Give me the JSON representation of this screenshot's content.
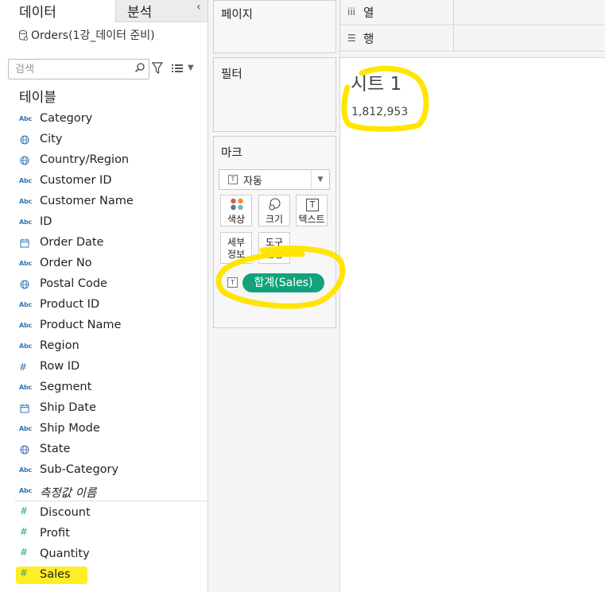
{
  "sidebar": {
    "tab_data": "데이터",
    "tab_analysis": "분석",
    "collapse_glyph": "‹",
    "datasource": "Orders(1강_데이터 준비)",
    "search_placeholder": "검색",
    "tables_heading": "테이블",
    "dimensions": [
      {
        "type": "Abc",
        "name": "Category"
      },
      {
        "type": "globe",
        "name": "City"
      },
      {
        "type": "globe",
        "name": "Country/Region"
      },
      {
        "type": "Abc",
        "name": "Customer ID"
      },
      {
        "type": "Abc",
        "name": "Customer Name"
      },
      {
        "type": "Abc",
        "name": "ID"
      },
      {
        "type": "date",
        "name": "Order Date"
      },
      {
        "type": "Abc",
        "name": "Order No"
      },
      {
        "type": "globe",
        "name": "Postal Code"
      },
      {
        "type": "Abc",
        "name": "Product ID"
      },
      {
        "type": "Abc",
        "name": "Product Name"
      },
      {
        "type": "Abc",
        "name": "Region"
      },
      {
        "type": "#",
        "name": "Row ID"
      },
      {
        "type": "Abc",
        "name": "Segment"
      },
      {
        "type": "date",
        "name": "Ship Date"
      },
      {
        "type": "Abc",
        "name": "Ship Mode"
      },
      {
        "type": "globe",
        "name": "State"
      },
      {
        "type": "Abc",
        "name": "Sub-Category"
      },
      {
        "type": "Abc",
        "name": "측정값 이름",
        "italic": true
      }
    ],
    "measures": [
      {
        "type": "#",
        "name": "Discount"
      },
      {
        "type": "#",
        "name": "Profit"
      },
      {
        "type": "#",
        "name": "Quantity"
      },
      {
        "type": "#",
        "name": "Sales"
      }
    ]
  },
  "shelves": {
    "pages_title": "페이지",
    "filters_title": "필터",
    "marks_title": "마크",
    "mark_type": "자동",
    "text_glyph": "T",
    "mark_buttons": [
      "색상",
      "크기",
      "텍스트",
      "세부\n정보",
      "도구\n설명"
    ],
    "pill": "합계(Sales)",
    "columns_label": "열",
    "rows_label": "행"
  },
  "sheet": {
    "title": "시트 1",
    "value": "1,812,953"
  },
  "colors": {
    "highlight": "#ffea00",
    "pill": "#12a37c",
    "dimension_icon": "#3a75b0",
    "measure_icon": "#31a58f"
  }
}
